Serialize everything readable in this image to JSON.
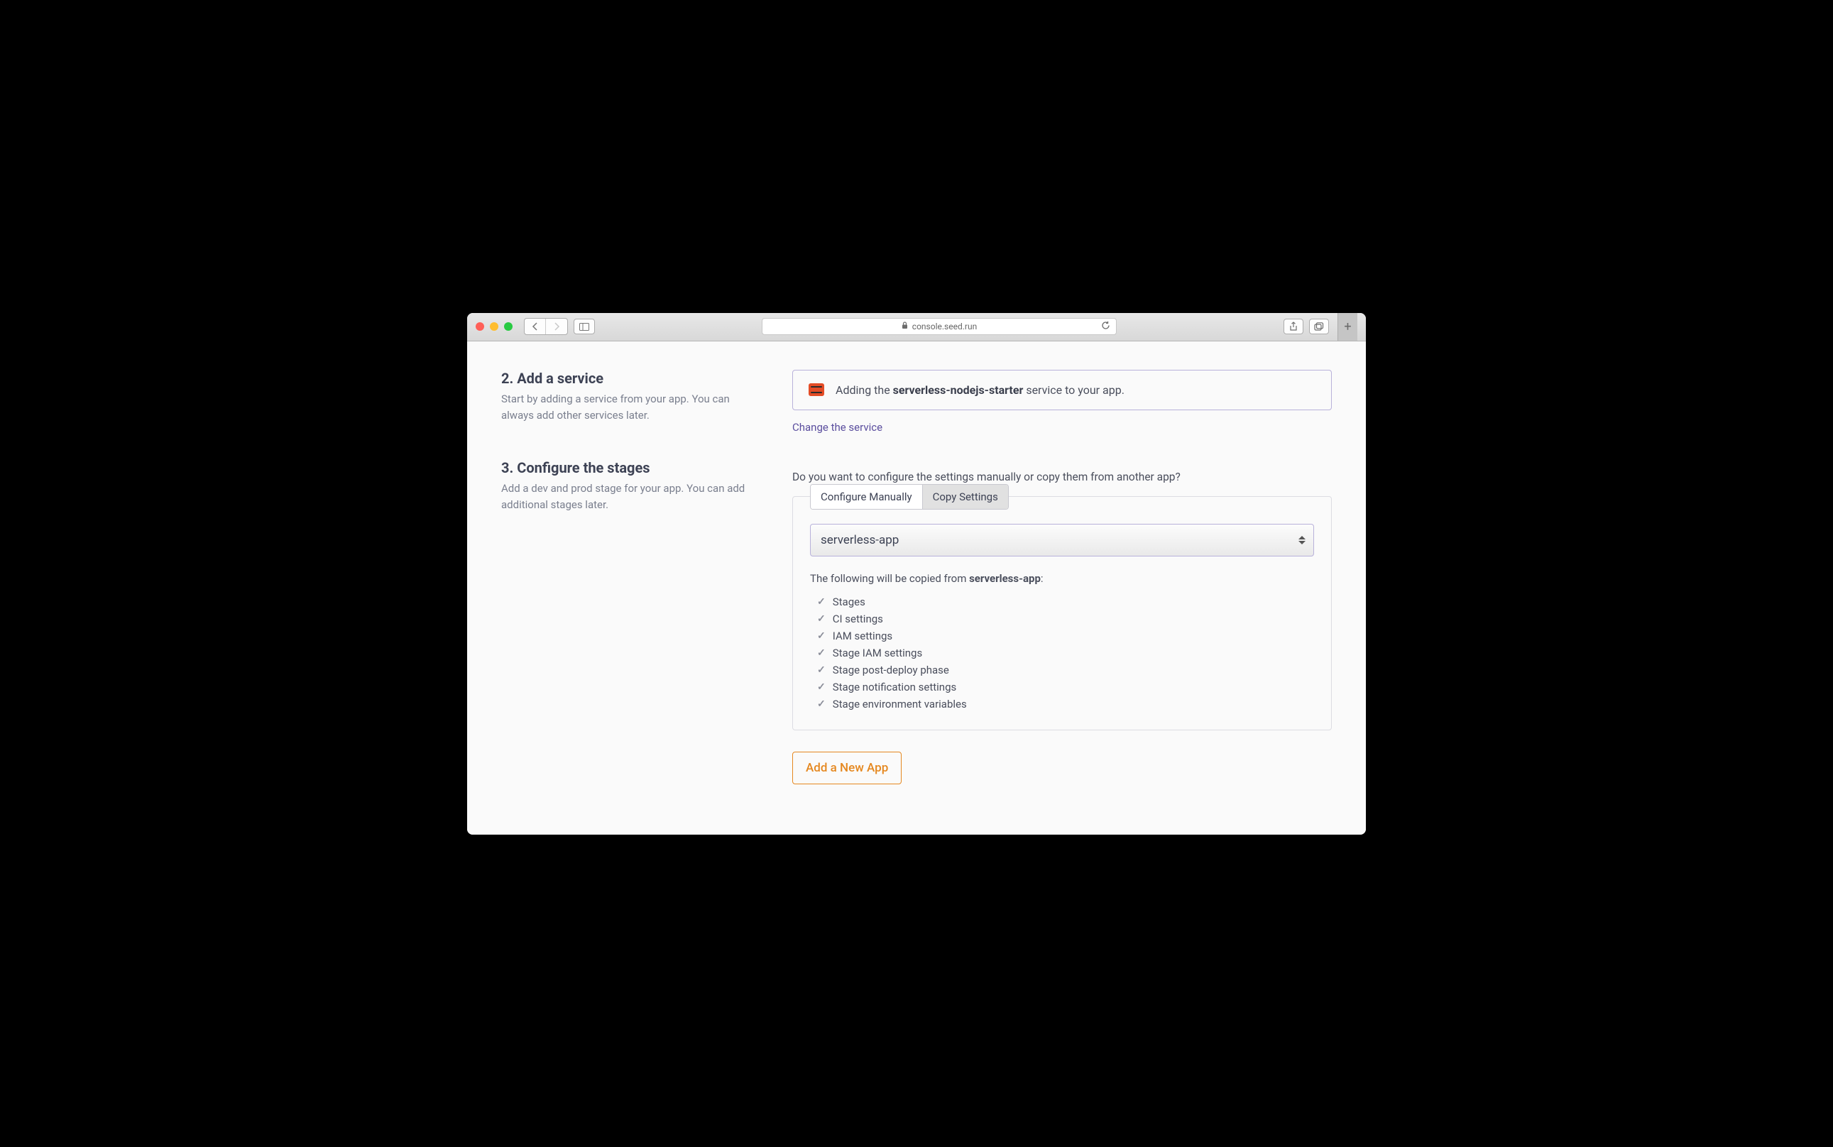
{
  "browser": {
    "url": "console.seed.run"
  },
  "steps": {
    "s2": {
      "title": "2. Add a service",
      "desc": "Start by adding a service from your app. You can always add other services later."
    },
    "s3": {
      "title": "3. Configure the stages",
      "desc": "Add a dev and prod stage for your app. You can add additional stages later."
    }
  },
  "service": {
    "banner_prefix": "Adding the ",
    "banner_name": "serverless-nodejs-starter",
    "banner_suffix": " service to your app.",
    "change_link": "Change the service"
  },
  "configure": {
    "prompt": "Do you want to configure the settings manually or copy them from another app?",
    "tab_manual": "Configure Manually",
    "tab_copy": "Copy Settings",
    "selected_app": "serverless-app",
    "copy_desc_prefix": "The following will be copied from ",
    "copy_desc_app": "serverless-app",
    "copy_desc_suffix": ":",
    "items": [
      "Stages",
      "CI settings",
      "IAM settings",
      "Stage IAM settings",
      "Stage post-deploy phase",
      "Stage notification settings",
      "Stage environment variables"
    ]
  },
  "actions": {
    "add_app": "Add a New App"
  }
}
